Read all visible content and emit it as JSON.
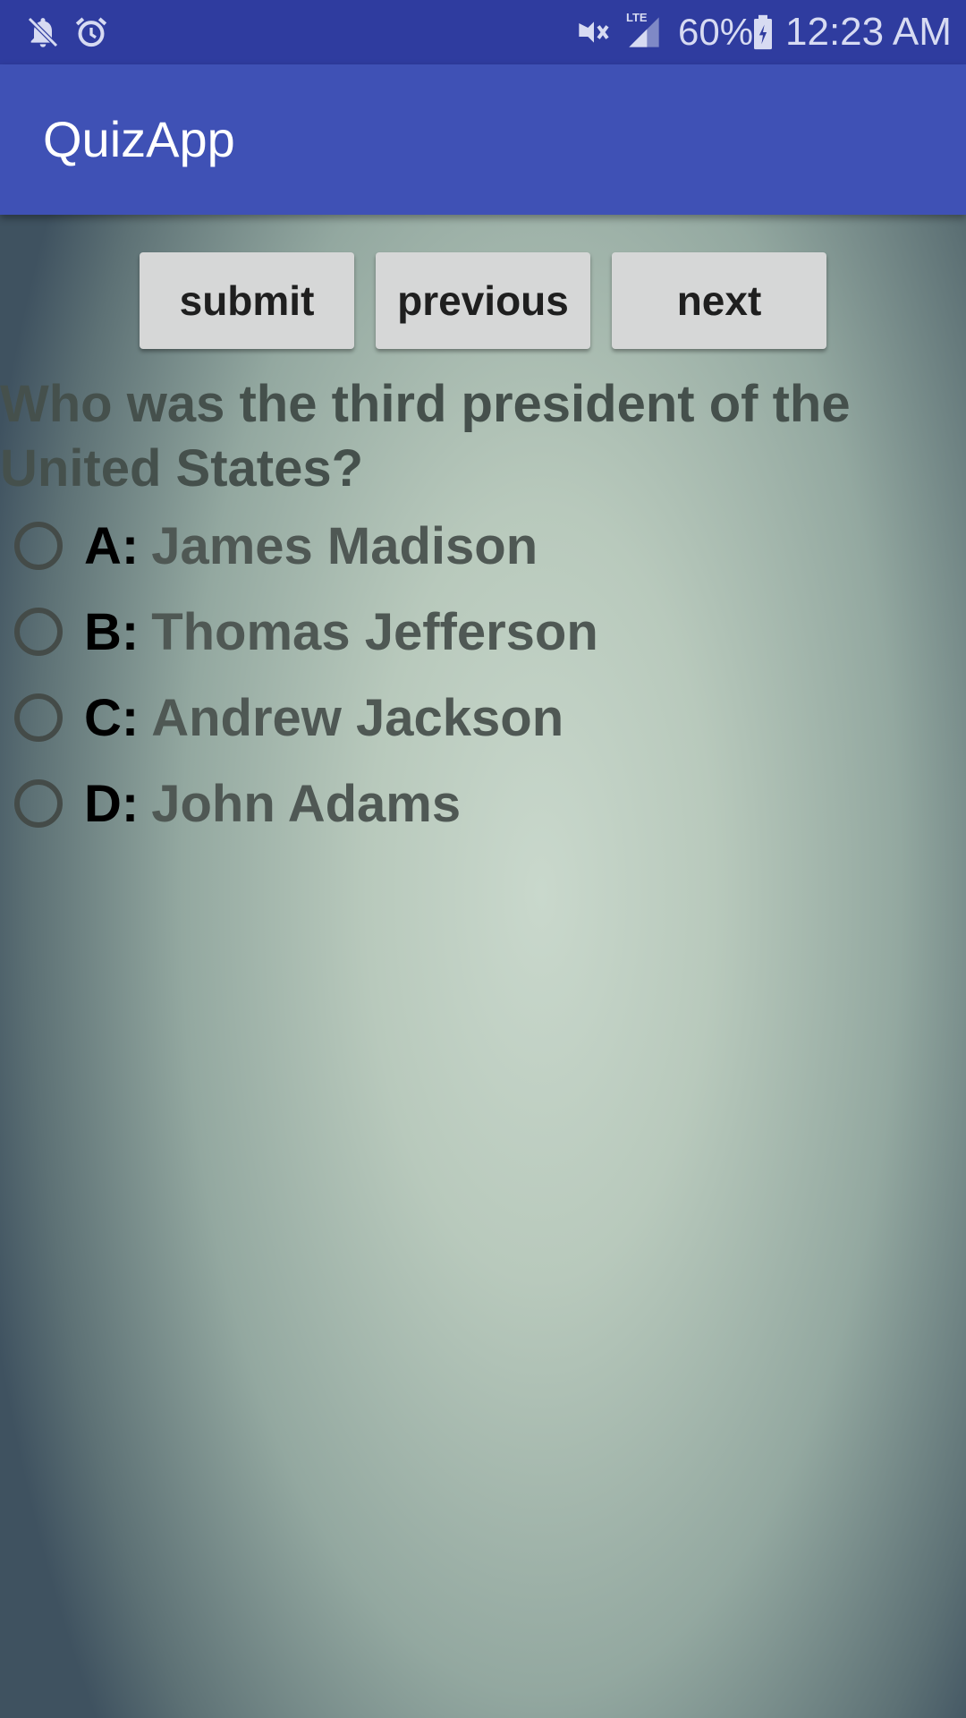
{
  "status_bar": {
    "icons_left": [
      "notifications-off-icon",
      "alarm-icon"
    ],
    "icons_right": [
      "vibrate-icon",
      "lte-signal-icon",
      "battery-charging-icon"
    ],
    "network_label": "LTE",
    "battery_percent": "60%",
    "time": "12:23 AM"
  },
  "app_bar": {
    "title": "QuizApp",
    "color": "#3f51b5"
  },
  "buttons": {
    "submit": "submit",
    "previous": "previous",
    "next": "next"
  },
  "question": {
    "text": "Who was the third president of the United States?"
  },
  "options": [
    {
      "letter": "A:",
      "text": "James Madison"
    },
    {
      "letter": "B:",
      "text": "Thomas Jefferson"
    },
    {
      "letter": "C:",
      "text": "Andrew Jackson"
    },
    {
      "letter": "D:",
      "text": "John Adams"
    }
  ]
}
